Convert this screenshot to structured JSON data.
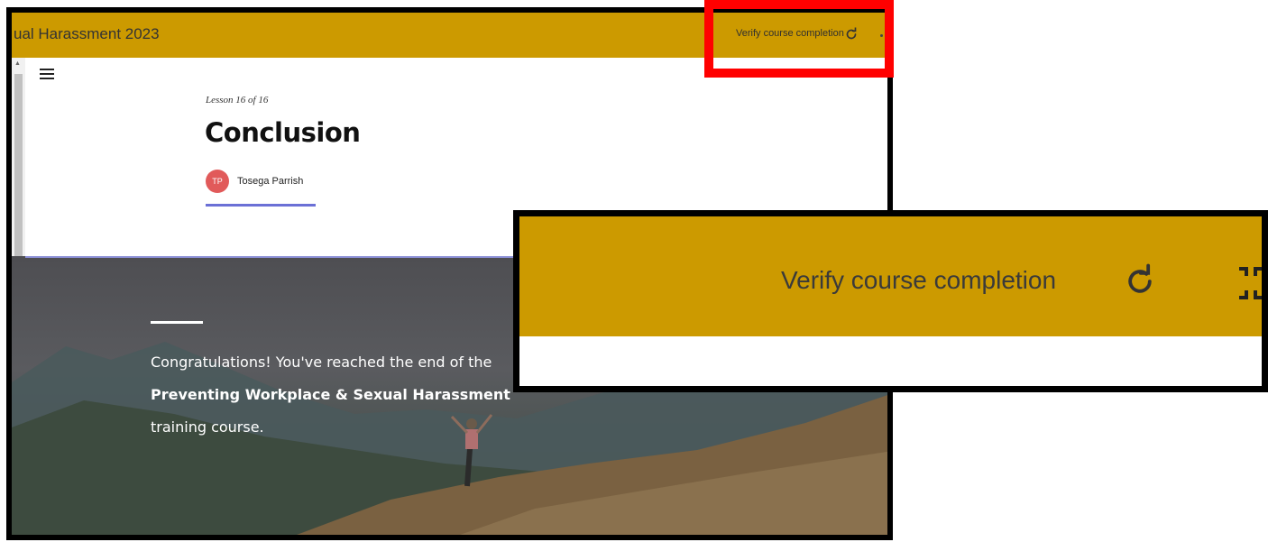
{
  "header": {
    "course_title": "ual Harassment 2023",
    "verify_label": "Verify course completion"
  },
  "lesson": {
    "counter": "Lesson 16 of 16",
    "title": "Conclusion",
    "author_initials": "TP",
    "author_name": "Tosega Parrish"
  },
  "hero": {
    "line1": "Congratulations! You've reached the end of the",
    "line2": "Preventing Workplace & Sexual Harassment",
    "line3": "training course."
  },
  "inset": {
    "verify_label": "Verify course completion"
  },
  "colors": {
    "topbar": "#cc9a00",
    "avatar": "#e15a5a",
    "accent_underline": "#6b70d6",
    "highlight": "#ff0000"
  },
  "icons": [
    "menu-icon",
    "refresh-icon",
    "exit-fullscreen-icon"
  ]
}
